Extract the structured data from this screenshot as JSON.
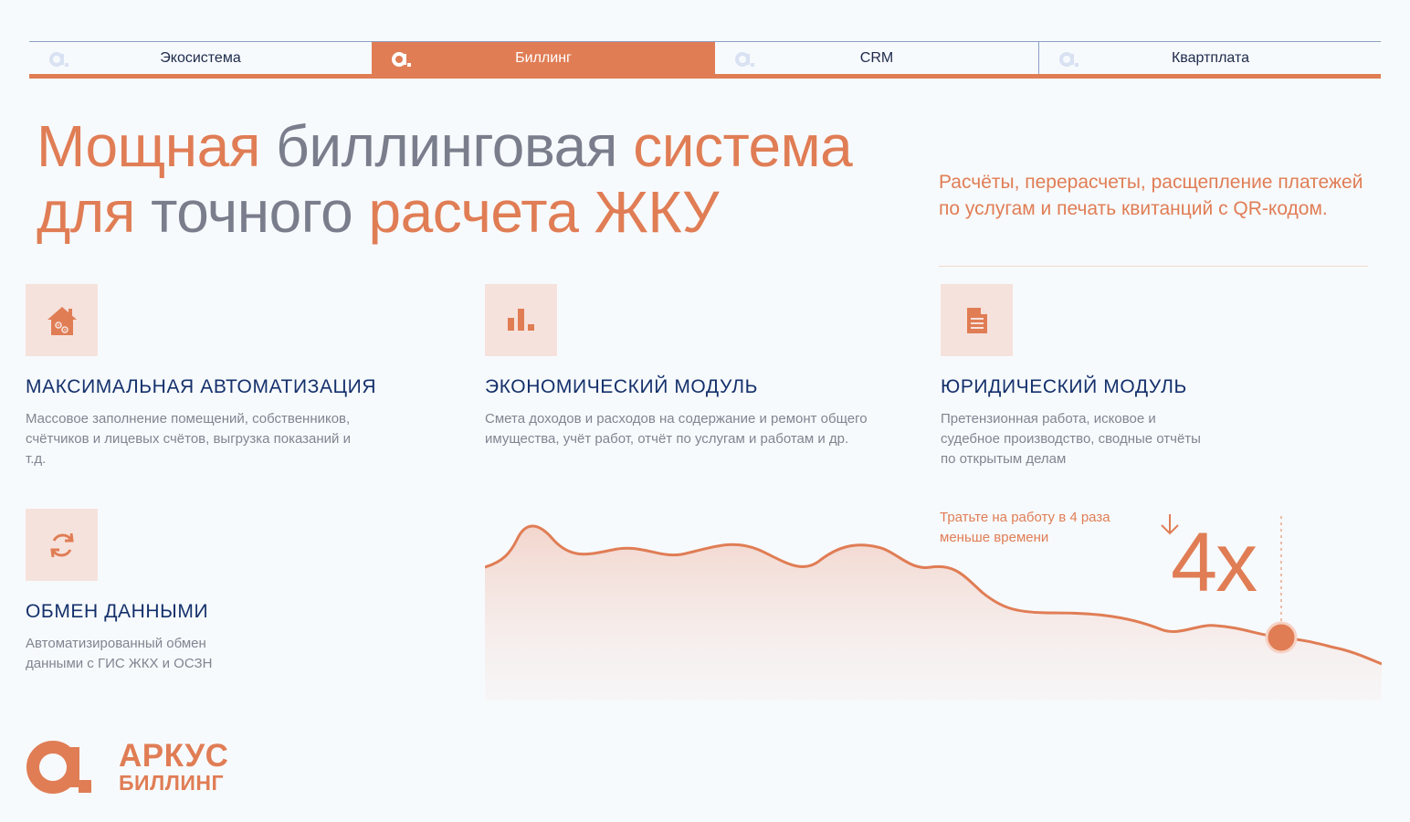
{
  "tabs": [
    {
      "label": "Экосистема",
      "active": false
    },
    {
      "label": "Биллинг",
      "active": true
    },
    {
      "label": "CRM",
      "active": false
    },
    {
      "label": "Квартплата",
      "active": false
    }
  ],
  "headline": {
    "part1": "Мощная",
    "part2": " биллинговая ",
    "part3": "система",
    "part4": "для",
    "part5": " точного ",
    "part6": "расчета ЖКУ"
  },
  "subheading": "Расчёты, перерасчеты, расщепление платежей по услугам и печать квитанций с QR-кодом.",
  "features": [
    {
      "icon": "house-gears-icon",
      "title": "МАКСИМАЛЬНАЯ АВТОМАТИЗАЦИЯ",
      "text": "Массовое заполнение помещений, собственников, счётчиков и лицевых счётов, выгрузка показаний и т.д."
    },
    {
      "icon": "bar-chart-icon",
      "title": "ЭКОНОМИЧЕСКИЙ МОДУЛЬ",
      "text": "Смета доходов и расходов на содержание и ремонт общего имущества, учёт работ, отчёт по услугам и работам и др."
    },
    {
      "icon": "document-icon",
      "title": "ЮРИДИЧЕСКИЙ МОДУЛЬ",
      "text": "Претензионная работа, исковое и судебное производство, сводные отчёты по открытым делам"
    },
    {
      "icon": "sync-arrows-icon",
      "title": "ОБМЕН ДАННЫМИ",
      "text": "Автоматизированный обмен данными с ГИС ЖКХ и ОСЗН"
    }
  ],
  "chart": {
    "note": "Тратьте на работу в 4 раза меньше времени",
    "multiplier": "4x"
  },
  "brand": {
    "name": "АРКУС",
    "sub": "БИЛЛИНГ"
  },
  "colors": {
    "accent": "#e07d55",
    "navy": "#14306b",
    "gray": "#7a7e8c",
    "icon_bg": "#f6e2dc"
  }
}
